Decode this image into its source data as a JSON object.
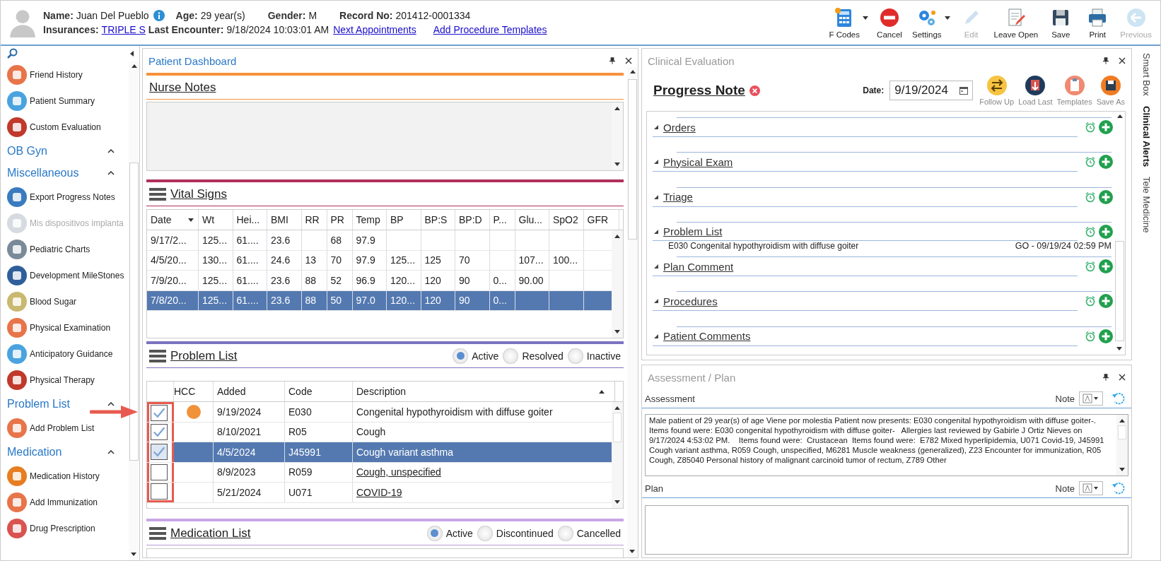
{
  "header": {
    "name_label": "Name:",
    "name": "Juan Del Pueblo",
    "age_label": "Age:",
    "age": "29 year(s)",
    "gender_label": "Gender:",
    "gender": "M",
    "record_label": "Record No:",
    "record": "201412-0001334",
    "insurances_label": "Insurances:",
    "insurance": "TRIPLE S",
    "last_encounter_label": "Last Encounter:",
    "last_encounter": "9/18/2024 10:03:01 AM",
    "links": [
      "Next Appointments",
      "Add Procedure Templates"
    ]
  },
  "toolbar": [
    {
      "label": "F Codes",
      "kind": "fcodes",
      "dropdown": true,
      "disabled": false
    },
    {
      "label": "Cancel",
      "kind": "cancel",
      "dropdown": false,
      "disabled": false
    },
    {
      "label": "Settings",
      "kind": "settings",
      "dropdown": true,
      "disabled": false
    },
    {
      "label": "Edit",
      "kind": "edit",
      "dropdown": false,
      "disabled": true
    },
    {
      "label": "Leave Open",
      "kind": "leave-open",
      "dropdown": false,
      "disabled": false
    },
    {
      "label": "Save",
      "kind": "save",
      "dropdown": false,
      "disabled": false
    },
    {
      "label": "Print",
      "kind": "print",
      "dropdown": false,
      "disabled": false
    },
    {
      "label": "Previous",
      "kind": "previous",
      "dropdown": false,
      "disabled": true
    }
  ],
  "sidebar": {
    "sections": [
      {
        "items": [
          {
            "label": "Friend History",
            "disabled": false
          },
          {
            "label": "Patient Summary",
            "disabled": false
          },
          {
            "label": "Custom Evaluation",
            "disabled": false
          }
        ]
      },
      {
        "title": "OB Gyn",
        "expanded": true
      },
      {
        "title": "Miscellaneous",
        "expanded": true,
        "items": [
          {
            "label": "Export Progress Notes",
            "disabled": false
          },
          {
            "label": "Mis dispositivos implanta",
            "disabled": true
          },
          {
            "label": "Pediatric Charts",
            "disabled": false
          },
          {
            "label": "Development MileStones",
            "disabled": false
          },
          {
            "label": "Blood Sugar",
            "disabled": false
          },
          {
            "label": "Physical Examination",
            "disabled": false
          },
          {
            "label": "Anticipatory Guidance",
            "disabled": false
          },
          {
            "label": "Physical Therapy",
            "disabled": false
          }
        ]
      },
      {
        "title": "Problem List",
        "expanded": true,
        "items": [
          {
            "label": "Add Problem List",
            "disabled": false
          }
        ]
      },
      {
        "title": "Medication",
        "expanded": true,
        "items": [
          {
            "label": "Medication History",
            "disabled": false
          },
          {
            "label": "Add Immunization",
            "disabled": false
          },
          {
            "label": "Drug Prescription",
            "disabled": false
          }
        ]
      }
    ]
  },
  "dashboard": {
    "title": "Patient Dashboard",
    "nurse_notes": {
      "title": "Nurse Notes"
    },
    "vital_signs": {
      "title": "Vital Signs",
      "columns": [
        "Date",
        "Wt",
        "Hei...",
        "BMI",
        "RR",
        "PR",
        "Temp",
        "BP",
        "BP:S",
        "BP:D",
        "P...",
        "Glu...",
        "SpO2",
        "GFR"
      ],
      "rows": [
        {
          "selected": false,
          "cells": [
            "9/17/2...",
            "125...",
            "61....",
            "23.6",
            "",
            "68",
            "97.9",
            "",
            "",
            "",
            "",
            "",
            "",
            ""
          ]
        },
        {
          "selected": false,
          "cells": [
            "4/5/20...",
            "130...",
            "61....",
            "24.6",
            "13",
            "70",
            "97.9",
            "125...",
            "125",
            "70",
            "",
            "107...",
            "100...",
            ""
          ]
        },
        {
          "selected": false,
          "cells": [
            "7/9/20...",
            "125...",
            "61....",
            "23.6",
            "88",
            "52",
            "96.9",
            "120...",
            "120",
            "90",
            "0...",
            "90.00",
            "",
            ""
          ]
        },
        {
          "selected": true,
          "cells": [
            "7/8/20...",
            "125...",
            "61....",
            "23.6",
            "88",
            "50",
            "97.0",
            "120...",
            "120",
            "90",
            "0...",
            "",
            "",
            ""
          ]
        }
      ]
    },
    "problem_list": {
      "title": "Problem List",
      "filters": [
        {
          "label": "Active",
          "selected": true
        },
        {
          "label": "Resolved",
          "selected": false
        },
        {
          "label": "Inactive",
          "selected": false
        }
      ],
      "columns": [
        "HCC",
        "Added",
        "Code",
        "Description"
      ],
      "rows": [
        {
          "checked": true,
          "hcc": true,
          "added": "9/19/2024",
          "code": "E030",
          "description": "Congenital hypothyroidism with diffuse goiter",
          "linked": false,
          "selected": false
        },
        {
          "checked": true,
          "hcc": false,
          "added": "8/10/2021",
          "code": "R05",
          "description": "Cough",
          "linked": false,
          "selected": false
        },
        {
          "checked": true,
          "hcc": false,
          "added": "4/5/2024",
          "code": "J45991",
          "description": "Cough variant asthma",
          "linked": false,
          "selected": true
        },
        {
          "checked": false,
          "hcc": false,
          "added": "8/9/2023",
          "code": "R059",
          "description": "Cough, unspecified",
          "linked": true,
          "selected": false
        },
        {
          "checked": false,
          "hcc": false,
          "added": "5/21/2024",
          "code": "U071",
          "description": "COVID-19",
          "linked": true,
          "selected": false
        }
      ]
    },
    "medication_list": {
      "title": "Medication List",
      "filters": [
        {
          "label": "Active",
          "selected": true
        },
        {
          "label": "Discontinued",
          "selected": false
        },
        {
          "label": "Cancelled",
          "selected": false
        }
      ]
    }
  },
  "clinical_evaluation": {
    "title": "Clinical Evaluation",
    "note_title": "Progress Note",
    "date_label": "Date:",
    "date": "9/19/2024",
    "actions": [
      {
        "label": "Follow Up",
        "kind": "follow-up"
      },
      {
        "label": "Load Last",
        "kind": "load-last"
      },
      {
        "label": "Templates",
        "kind": "templates"
      },
      {
        "label": "Save As",
        "kind": "save-as"
      }
    ],
    "sections": [
      {
        "title": "Orders",
        "expanded": true
      },
      {
        "title": "Physical Exam",
        "expanded": true
      },
      {
        "title": "Triage",
        "expanded": true
      },
      {
        "title": "Problem List",
        "expanded": true,
        "entry": "E030 Congenital hypothyroidism with diffuse goiter",
        "entry_meta": "GO - 09/19/24 02:59 PM"
      },
      {
        "title": "Plan Comment",
        "expanded": true
      },
      {
        "title": "Procedures",
        "expanded": true
      },
      {
        "title": "Patient Comments",
        "expanded": true
      }
    ]
  },
  "assessment_plan": {
    "title": "Assessment / Plan",
    "assessment_label": "Assessment",
    "assessment_note": "Note",
    "assessment_text": "Male patient of 29 year(s) of age Viene por molestia Patient now presents: E030 congenital hypothyroidism with diffuse goiter-. Items found were: E030 congenital hypothyroidism with diffuse goiter-   Allergies last reviewed by Gabirle J Ortiz Nieves on 9/17/2024 4:53:02 PM.    Items found were:  Crustacean  Items found were:  E782 Mixed hyperlipidemia, U071 Covid-19, J45991 Cough variant asthma, R059 Cough, unspecified, M6281 Muscle weakness (generalized), Z23 Encounter for immunization, R05 Cough, Z85040 Personal history of malignant carcinoid tumor of rectum, Z789 Other",
    "plan_label": "Plan",
    "plan_note": "Note"
  },
  "side_tabs": [
    {
      "label": "Smart Box",
      "selected": false
    },
    {
      "label": "Clinical Alerts",
      "selected": true
    },
    {
      "label": "Tele Medicine",
      "selected": false
    }
  ]
}
